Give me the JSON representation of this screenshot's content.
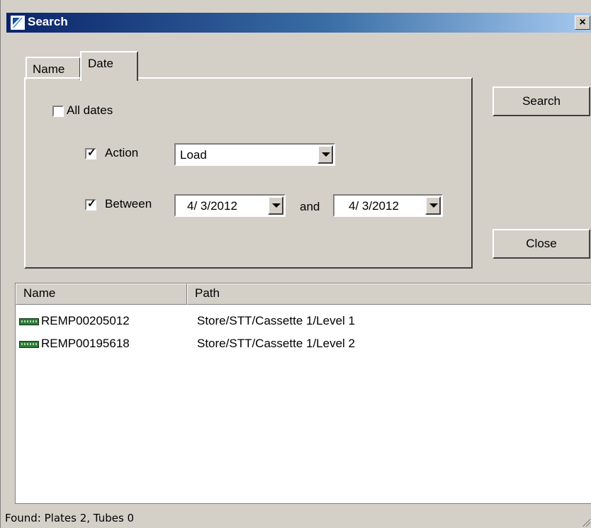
{
  "window": {
    "title": "Search",
    "close_glyph": "×"
  },
  "tabs": [
    {
      "label": "Name",
      "active": false
    },
    {
      "label": "Date",
      "active": true
    }
  ],
  "date_panel": {
    "all_dates": {
      "label": "All dates",
      "checked": false
    },
    "action": {
      "label": "Action",
      "checked": true,
      "value": "Load"
    },
    "between": {
      "label": "Between",
      "checked": true,
      "from": "4/ 3/2012",
      "connector": "and",
      "to": "4/ 3/2012"
    }
  },
  "buttons": {
    "search": "Search",
    "close": "Close"
  },
  "results": {
    "columns": [
      "Name",
      "Path"
    ],
    "rows": [
      {
        "name": "REMP00205012",
        "path": "Store/STT/Cassette 1/Level 1",
        "icon": "plate-icon"
      },
      {
        "name": "REMP00195618",
        "path": "Store/STT/Cassette 1/Level 2",
        "icon": "plate-icon"
      }
    ]
  },
  "status": {
    "text": "Found: Plates 2, Tubes 0"
  },
  "colors": {
    "titlebar_start": "#0a246a",
    "titlebar_end": "#a6caf0",
    "face": "#d4d0c8",
    "plate_icon": "#2f7a3b"
  }
}
